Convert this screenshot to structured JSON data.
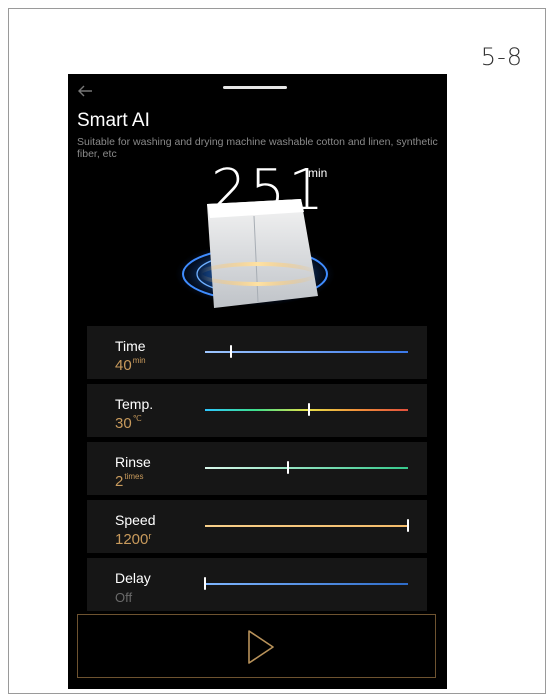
{
  "page": {
    "number": "5-8"
  },
  "header": {
    "back_icon": "back-arrow-icon"
  },
  "program": {
    "title": "Smart AI",
    "description": "Suitable for washing and drying machine washable cotton and linen, synthetic fiber, etc",
    "duration_value": "251",
    "duration_unit": "min"
  },
  "settings": [
    {
      "label": "Time",
      "value": "40",
      "unit": "min",
      "level": 0.13
    },
    {
      "label": "Temp.",
      "value": "30",
      "unit": "℃",
      "level": 0.51
    },
    {
      "label": "Rinse",
      "value": "2",
      "unit": "times",
      "level": 0.41
    },
    {
      "label": "Speed",
      "value": "1200",
      "unit": "r",
      "level": 1.0
    },
    {
      "label": "Delay",
      "value": "Off",
      "unit": "",
      "level": 0.0
    }
  ],
  "colors": {
    "background": "#000000",
    "accent_value": "#c89a5c",
    "time_track": "#3b78e7",
    "rinse_track": "#36c98c",
    "speed_track": "#f3bb6a",
    "delay_track": "#2e6cc9",
    "start_border": "#6e5330"
  },
  "start": {
    "icon": "play-icon"
  }
}
